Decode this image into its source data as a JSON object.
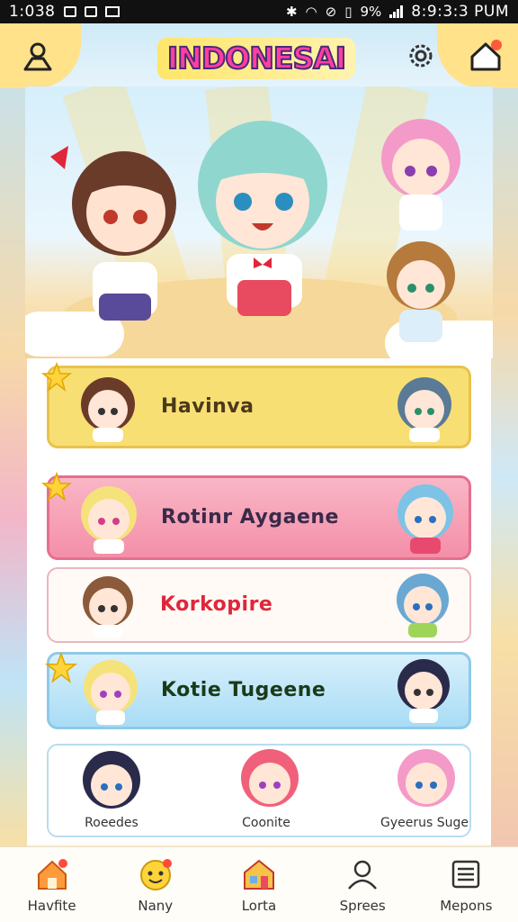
{
  "status_bar": {
    "time_left": "1:038",
    "battery_percent": "9%",
    "time_right": "8:9:3:3 PUM"
  },
  "header": {
    "title": "INDONESAI",
    "left_icon": "profile-icon",
    "settings_icon": "gear-icon",
    "right_icon": "home-notification-icon"
  },
  "colors": {
    "title_pink": "#ff3fa0",
    "yellow_card": "#f8df74",
    "pink_card": "#f6a3b6",
    "blue_card": "#bfe5f8",
    "corner_yellow": "#ffe28a"
  },
  "list": [
    {
      "label": "Havinva",
      "style": "yellow"
    },
    {
      "label": "Rotinr Aygaene",
      "style": "pink"
    },
    {
      "label": "Korkopire",
      "style": "white"
    },
    {
      "label": "Kotie Tugeene",
      "style": "blue"
    }
  ],
  "multi_card": {
    "items": [
      {
        "label": "Roeedes"
      },
      {
        "label": "Coonite"
      },
      {
        "label": "Gyeerus Suge"
      }
    ]
  },
  "bottom_nav": [
    {
      "label": "Havfite",
      "icon": "house-icon"
    },
    {
      "label": "Nany",
      "icon": "smiley-icon"
    },
    {
      "label": "Lorta",
      "icon": "shop-icon"
    },
    {
      "label": "Sprees",
      "icon": "person-icon"
    },
    {
      "label": "Mepons",
      "icon": "document-icon"
    }
  ]
}
